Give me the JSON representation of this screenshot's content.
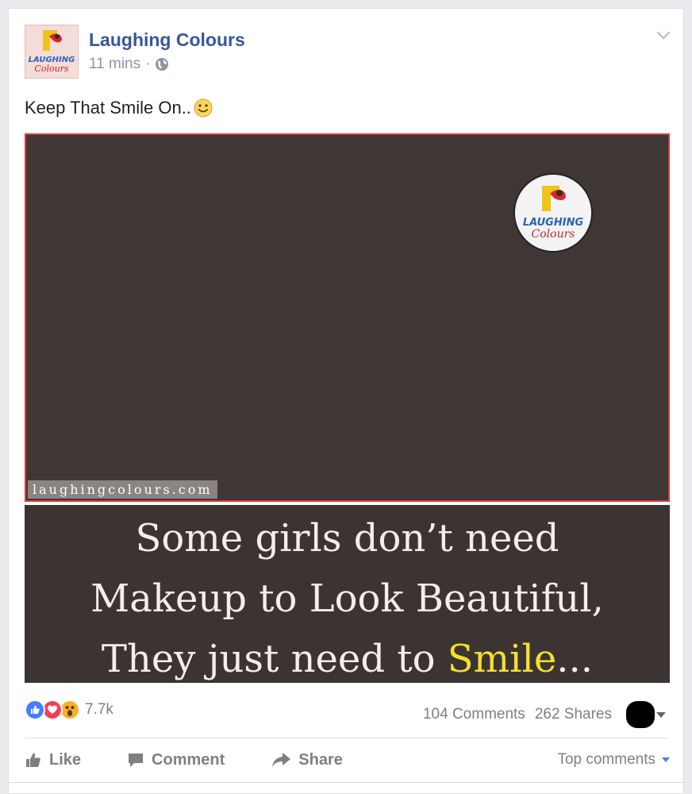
{
  "post": {
    "page_name": "Laughing Colours",
    "time": "11 mins",
    "separator": "·",
    "text": "Keep That Smile On..",
    "logo_text_top": "LAUGHING",
    "logo_text_bottom": "Colours"
  },
  "video": {
    "watermark": "laughingcolours.com"
  },
  "caption_image": {
    "line1": "Some girls don’t need",
    "line2": "Makeup to Look Beautiful,",
    "line3_prefix": "They just need to ",
    "line3_highlight": "Smile",
    "line3_suffix": "..."
  },
  "reactions": {
    "types": [
      "like-icon",
      "love-icon",
      "wow-icon"
    ],
    "count": "7.7k"
  },
  "stats": {
    "comments": "104 Comments",
    "shares": "262 Shares"
  },
  "actions": {
    "like": "Like",
    "comment": "Comment",
    "share": "Share",
    "sort": "Top comments"
  },
  "colors": {
    "link_blue": "#365899",
    "like_blue": "#4080ff",
    "love_red": "#f33e58",
    "wow_yellow": "#f7b125",
    "video_border": "#d9393b",
    "highlight_yellow": "#f4e02a"
  }
}
